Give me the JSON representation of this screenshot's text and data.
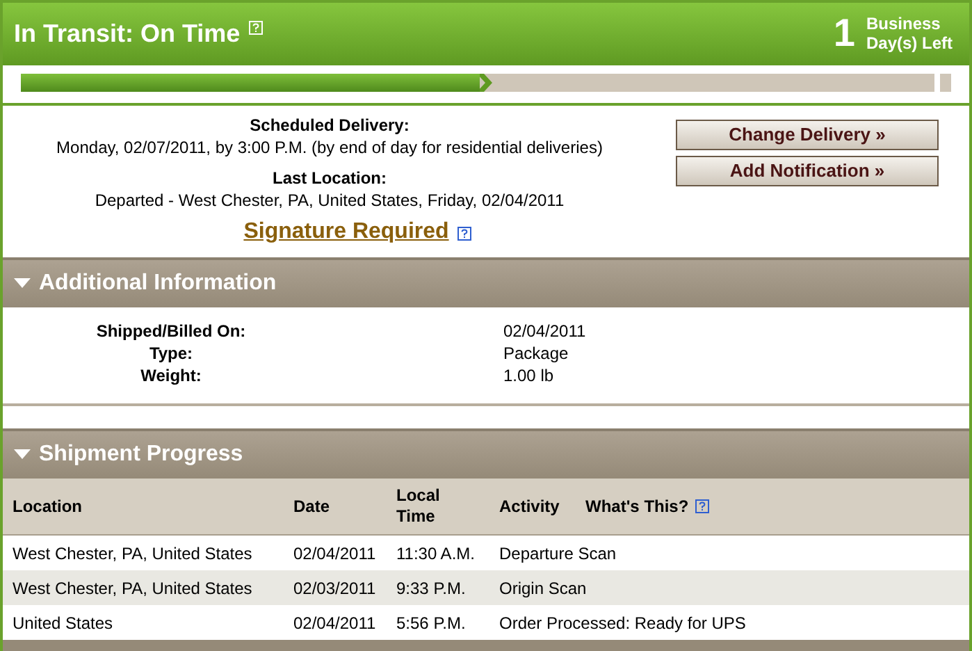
{
  "status": {
    "title": "In Transit: On Time",
    "days_left": "1",
    "days_left_label": "Business Day(s) Left"
  },
  "progress": {
    "level": 0.5
  },
  "delivery": {
    "scheduled_label": "Scheduled Delivery:",
    "scheduled_value": "Monday, 02/07/2011, by 3:00 P.M. (by end of day for residential deliveries)",
    "last_location_label": "Last Location:",
    "last_location_value": "Departed - West Chester, PA, United States, Friday, 02/04/2011",
    "signature_link": "Signature Required"
  },
  "buttons": [
    "Change Delivery »",
    "Add Notification »"
  ],
  "additional_information": {
    "title": "Additional Information",
    "expanded": true,
    "fields": [
      {
        "label": "Shipped/Billed On:",
        "value": "02/04/2011"
      },
      {
        "label": "Type:",
        "value": "Package"
      },
      {
        "label": "Weight:",
        "value": "1.00 lb"
      }
    ]
  },
  "shipment_progress": {
    "title": "Shipment Progress",
    "expanded": true,
    "columns": [
      "Location",
      "Date",
      "Local Time",
      "Activity",
      "What's This?"
    ],
    "rows": [
      [
        "West Chester, PA, United States",
        "02/04/2011",
        "11:30 A.M.",
        "Departure Scan"
      ],
      [
        "West Chester, PA, United States",
        "02/03/2011",
        "9:33 P.M.",
        "Origin Scan"
      ],
      [
        "United States",
        "02/04/2011",
        "5:56 P.M.",
        "Order Processed: Ready for UPS"
      ]
    ]
  }
}
